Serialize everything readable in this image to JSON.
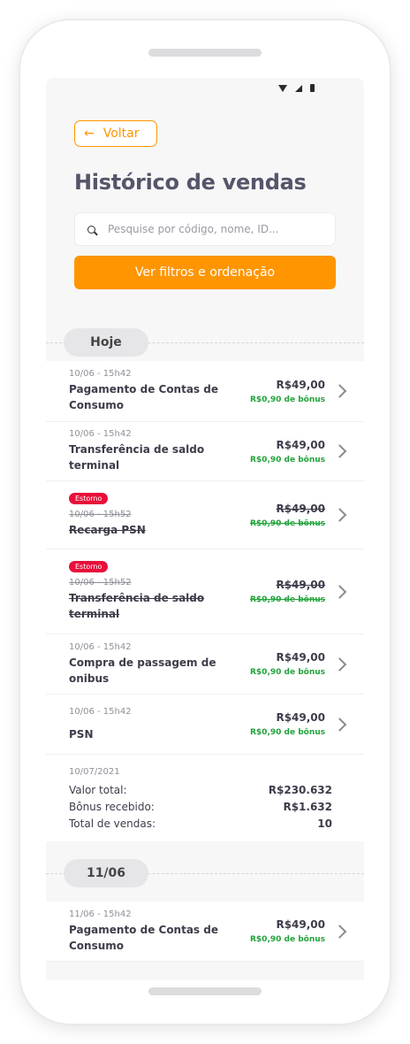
{
  "header": {
    "back_label": "Voltar",
    "title": "Histórico de vendas"
  },
  "search": {
    "placeholder": "Pesquise por código, nome, ID..."
  },
  "filters_button": "Ver filtros e ordenação",
  "sections": [
    {
      "date_label": "Hoje",
      "transactions": [
        {
          "timestamp": "10/06 - 15h42",
          "description": "Pagamento de Contas de Consumo",
          "amount": "R$49,00",
          "bonus": "R$0,90 de bônus"
        },
        {
          "timestamp": "10/06 - 15h42",
          "description": "Transferência de saldo terminal",
          "amount": "R$49,00",
          "bonus": "R$0,90 de bônus"
        },
        {
          "tag": "Estorno",
          "timestamp": "10/06 - 15h52",
          "description": "Recarga PSN",
          "amount": "R$49,00",
          "bonus": "R$0,90 de bônus"
        },
        {
          "tag": "Estorno",
          "timestamp": "10/06 - 15h52",
          "description": "Transferência de saldo terminal",
          "amount": "R$49,00",
          "bonus": "R$0,90 de bônus"
        },
        {
          "timestamp": "10/06 - 15h42",
          "description": "Compra de passagem de onibus",
          "amount": "R$49,00",
          "bonus": "R$0,90 de bônus"
        },
        {
          "timestamp": "10/06 - 15h42",
          "description": "PSN",
          "amount": "R$49,00",
          "bonus": "R$0,90 de bônus"
        }
      ],
      "summary": {
        "date": "10/07/2021",
        "total_label": "Valor total:",
        "total_value": "R$230.632",
        "bonus_label": "Bônus recebido:",
        "bonus_value": "R$1.632",
        "count_label": "Total de vendas:",
        "count_value": "10"
      }
    },
    {
      "date_label": "11/06",
      "transactions": [
        {
          "timestamp": "11/06 - 15h42",
          "description": "Pagamento de Contas de Consumo",
          "amount": "R$49,00",
          "bonus": "R$0,90 de bônus"
        }
      ]
    }
  ]
}
